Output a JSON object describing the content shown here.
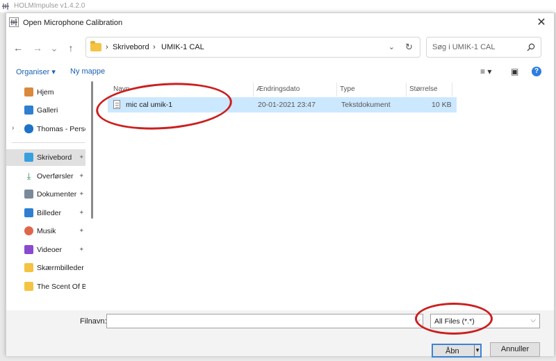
{
  "background_window": {
    "title": "HOLMImpulse  v1.4.2.0"
  },
  "dialog": {
    "title": "Open Microphone Calibration",
    "close_glyph": "✕"
  },
  "navigation": {
    "back": "←",
    "forward": "→",
    "recent": "⌄",
    "up": "↑",
    "breadcrumbs": [
      "Skrivebord",
      "UMIK-1 CAL"
    ],
    "separator": "›",
    "search_placeholder": "Søg i UMIK-1 CAL"
  },
  "toolbar": {
    "organize": "Organiser ▾",
    "new_folder": "Ny mappe",
    "view_glyph": "≡ ▾",
    "pane_glyph": "▣",
    "help_glyph": "?"
  },
  "sidebar": {
    "items": [
      {
        "label": "Hjem",
        "icon": "home-icon",
        "color": "#d9893d"
      },
      {
        "label": "Galleri",
        "icon": "gallery-icon",
        "color": "#2f7fd1"
      },
      {
        "label": "Thomas - Perso",
        "icon": "onedrive-icon",
        "color": "#1e73c8",
        "expander": "›"
      },
      {
        "label": "Skrivebord",
        "icon": "desktop-icon",
        "color": "#39a0e0",
        "pinned": true,
        "active": true
      },
      {
        "label": "Overførsler",
        "icon": "download-icon",
        "color": "#2a8f5a",
        "pinned": true
      },
      {
        "label": "Dokumenter",
        "icon": "documents-icon",
        "color": "#7a8a9a",
        "pinned": true
      },
      {
        "label": "Billeder",
        "icon": "pictures-icon",
        "color": "#2f7fd1",
        "pinned": true
      },
      {
        "label": "Musik",
        "icon": "music-icon",
        "color": "#e0664a",
        "pinned": true
      },
      {
        "label": "Videoer",
        "icon": "videos-icon",
        "color": "#8a4ad0",
        "pinned": true
      },
      {
        "label": "Skærmbilleder",
        "icon": "folder-icon",
        "color": "#f5c342"
      },
      {
        "label": "The Scent Of Blo",
        "icon": "folder-icon",
        "color": "#f5c342"
      }
    ],
    "pin_glyph": "📌"
  },
  "filelist": {
    "columns": [
      "Navn",
      "Ændringsdato",
      "Type",
      "Størrelse"
    ],
    "rows": [
      {
        "name": "mic cal umik-1",
        "date": "20-01-2021 23:47",
        "type": "Tekstdokument",
        "size": "10 KB"
      }
    ]
  },
  "bottom": {
    "filename_label": "Filnavn:",
    "filename_value": "",
    "filter_value": "All Files (*.*)",
    "open_label": "Åbn",
    "cancel_label": "Annuller"
  },
  "colors": {
    "annotation": "#cc1f1f",
    "accent": "#2d7de0",
    "selection": "#cce8ff"
  }
}
